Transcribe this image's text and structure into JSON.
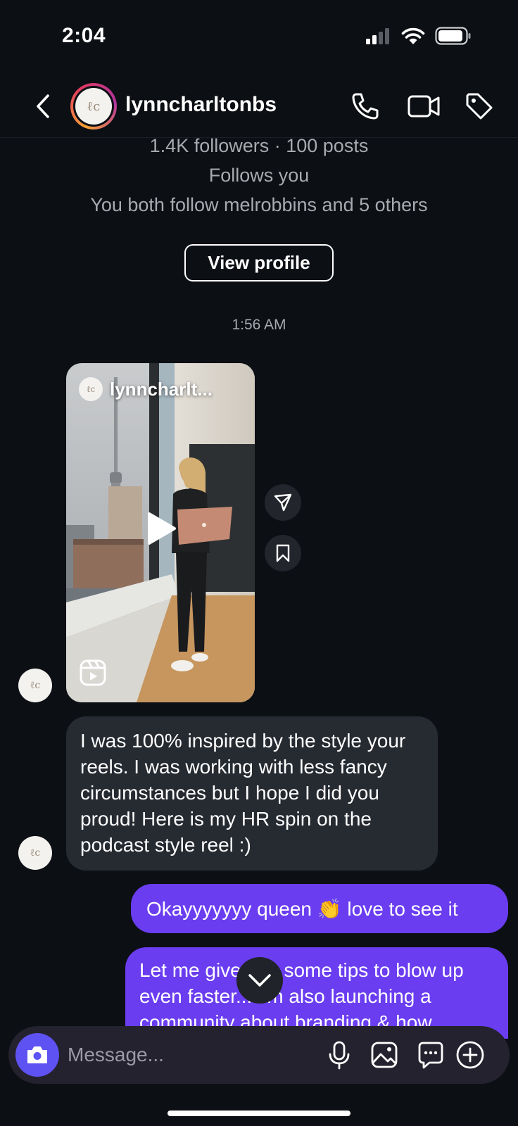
{
  "status_bar": {
    "time": "2:04"
  },
  "header": {
    "username": "lynncharltonbs"
  },
  "profile": {
    "stats": "1.4K followers · 100 posts",
    "follows_you": "Follows you",
    "mutuals": "You both follow melrobbins and 5 others",
    "view_profile_label": "View profile"
  },
  "conversation": {
    "timestamp": "1:56 AM",
    "reel": {
      "username": "lynncharlt..."
    },
    "messages": [
      {
        "from": "them",
        "text": "I was 100% inspired by the style your reels. I was working with less fancy circumstances but I hope I did you proud!  Here is my HR spin on the podcast style reel :)"
      },
      {
        "from": "me",
        "text": "Okayyyyyyy queen 👏 love to see it"
      },
      {
        "from": "me",
        "text": "Let me give you some tips to blow up even faster... I'm also launching a community about branding & how"
      }
    ]
  },
  "composer": {
    "placeholder": "Message..."
  },
  "colors": {
    "background": "#0c0f14",
    "outgoing_bubble": "#6a3df0",
    "incoming_bubble": "#262a31",
    "camera_button": "#5e52f3"
  }
}
